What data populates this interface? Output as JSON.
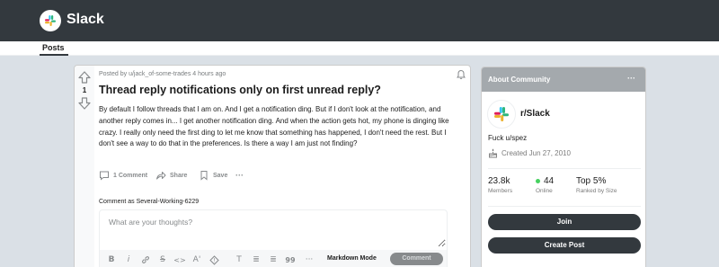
{
  "header": {
    "app_title": "Slack"
  },
  "tabs": [
    {
      "label": "Posts"
    }
  ],
  "post": {
    "score": "1",
    "meta": "Posted by u/jack_of-some-trades 4 hours ago",
    "title": "Thread reply notifications only on first unread reply?",
    "body": "By default I follow threads that I am on. And I get a notification ding. But if I don't look at the notification, and another reply comes in... I get another notification ding. And when the action gets hot, my phone is dinging like crazy. I really only need the first ding to let me know that something has happened, I don't need the rest. But I don't see a way to do that in the preferences. Is there a way I am just not finding?",
    "actions": {
      "comments": "1 Comment",
      "share": "Share",
      "save": "Save",
      "more": "···"
    }
  },
  "comment_box": {
    "comment_as": "Comment as Several-Working-6229",
    "placeholder": "What are your thoughts?",
    "toolbar": {
      "bold": "B",
      "italic": "i",
      "link": "🔗",
      "strike": "S",
      "code": "<>",
      "superscript": "A'",
      "spoiler": "!",
      "heading": "T",
      "bulleted": "≣",
      "numbered": "≣",
      "quote": "99",
      "more": "···"
    },
    "markdown_mode": "Markdown Mode",
    "submit": "Comment"
  },
  "sidebar": {
    "title": "About Community",
    "more": "···",
    "community_name": "r/Slack",
    "description": "Fuck u/spez",
    "created": "Created Jun 27, 2010",
    "stats": [
      {
        "value": "23.8k",
        "label": "Members"
      },
      {
        "value": "44",
        "label": "Online"
      },
      {
        "value": "Top 5%",
        "label": "Ranked by Size"
      }
    ],
    "join_label": "Join",
    "create_post_label": "Create Post"
  },
  "colors": {
    "header_bg": "#33393e",
    "page_bg": "#dae0e6",
    "sidebar_header_bg": "#a4a9ad",
    "button_bg": "#33393e",
    "online_dot": "#46d160"
  }
}
